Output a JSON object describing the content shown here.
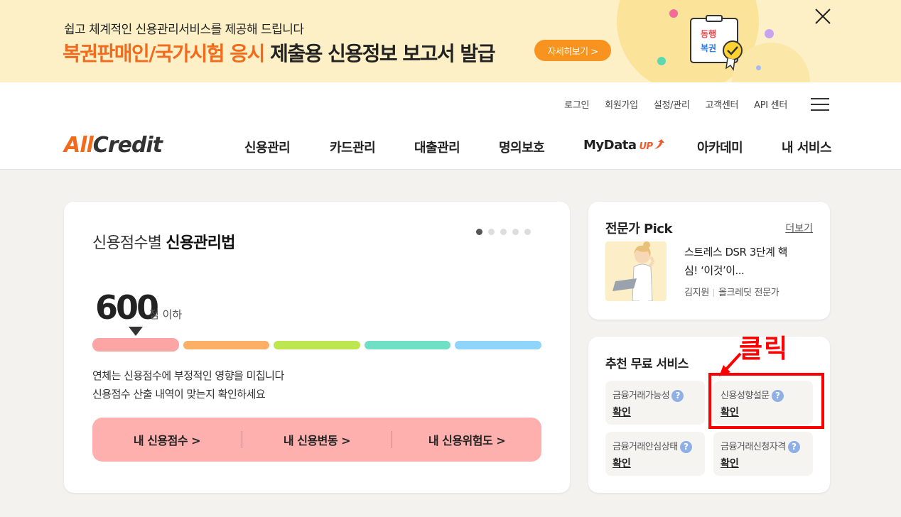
{
  "banner": {
    "subtitle": "쉽고 체계적인 신용관리서비스를 제공해 드립니다",
    "title_highlight": "복권판매인/국가시험 응시",
    "title_rest": " 제출용 신용정보 보고서 발급",
    "button": "자세히보기 >",
    "badge_text_1": "동행",
    "badge_text_2": "복권"
  },
  "header": {
    "util_links": [
      "로그인",
      "회원가입",
      "설정/관리",
      "고객센터",
      "API 센터"
    ],
    "logo_part1": "All",
    "logo_part2": "Credit",
    "nav": [
      "신용관리",
      "카드관리",
      "대출관리",
      "명의보호",
      "MyData",
      "아카데미",
      "내 서비스"
    ],
    "mydata_badge": "UP"
  },
  "main": {
    "title_plain": "신용점수별 ",
    "title_bold": "신용관리법",
    "score": "600",
    "score_unit": "점 이하",
    "bar_colors": [
      "#fca5a5",
      "#fbb065",
      "#bde651",
      "#6fe0c3",
      "#8fd4fb"
    ],
    "desc_line1": "연체는 신용점수에 부정적인 영향을 미칩니다",
    "desc_line2": "신용점수 산출 내역이 맞는지 확인하세요",
    "actions": [
      "내 신용점수 >",
      "내 신용변동 >",
      "내 신용위험도 >"
    ]
  },
  "pick": {
    "title": "전문가 Pick",
    "more": "더보기",
    "text_line1": "스트레스 DSR 3단계 핵",
    "text_line2": "심! ‘이것’이...",
    "author": "김지원",
    "author_role": "올크레딧 전문가"
  },
  "recommend": {
    "title": "추천 무료 서비스",
    "tiles": [
      {
        "label": "금융거래가능성",
        "value": "확인"
      },
      {
        "label": "신용성향설문",
        "value": "확인"
      },
      {
        "label": "금융거래안심상태",
        "value": "확인"
      },
      {
        "label": "금융거래신청자격",
        "value": "확인"
      }
    ]
  },
  "annotation": {
    "text": "클릭"
  }
}
